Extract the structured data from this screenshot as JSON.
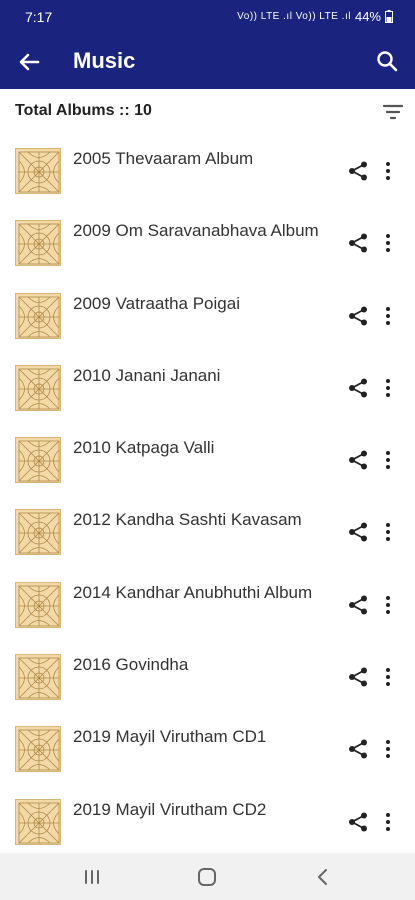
{
  "status": {
    "time": "7:17",
    "network": "Vo)) LTE .ıl Vo)) LTE .ıl",
    "battery": "44%"
  },
  "app_bar": {
    "title": "Music",
    "back_icon": "arrow-back-icon",
    "search_icon": "search-icon"
  },
  "summary": {
    "total_label": "Total Albums :: 10",
    "filter_icon": "filter-icon"
  },
  "albums": [
    {
      "title": "2005 Thevaaram Album"
    },
    {
      "title": "2009 Om Saravanabhava Album"
    },
    {
      "title": "2009 Vatraatha Poigai"
    },
    {
      "title": "2010 Janani Janani"
    },
    {
      "title": "2010 Katpaga Valli"
    },
    {
      "title": "2012 Kandha Sashti Kavasam"
    },
    {
      "title": "2014 Kandhar Anubhuthi Album"
    },
    {
      "title": "2016 Govindha"
    },
    {
      "title": "2019 Mayil Virutham CD1"
    },
    {
      "title": "2019 Mayil Virutham CD2"
    }
  ],
  "nav_bar": {
    "recents_icon": "recents-icon",
    "home_icon": "home-icon",
    "back_icon": "nav-back-icon"
  },
  "colors": {
    "app_bar": "#1a237e",
    "thumb": "#f3d9a6"
  }
}
